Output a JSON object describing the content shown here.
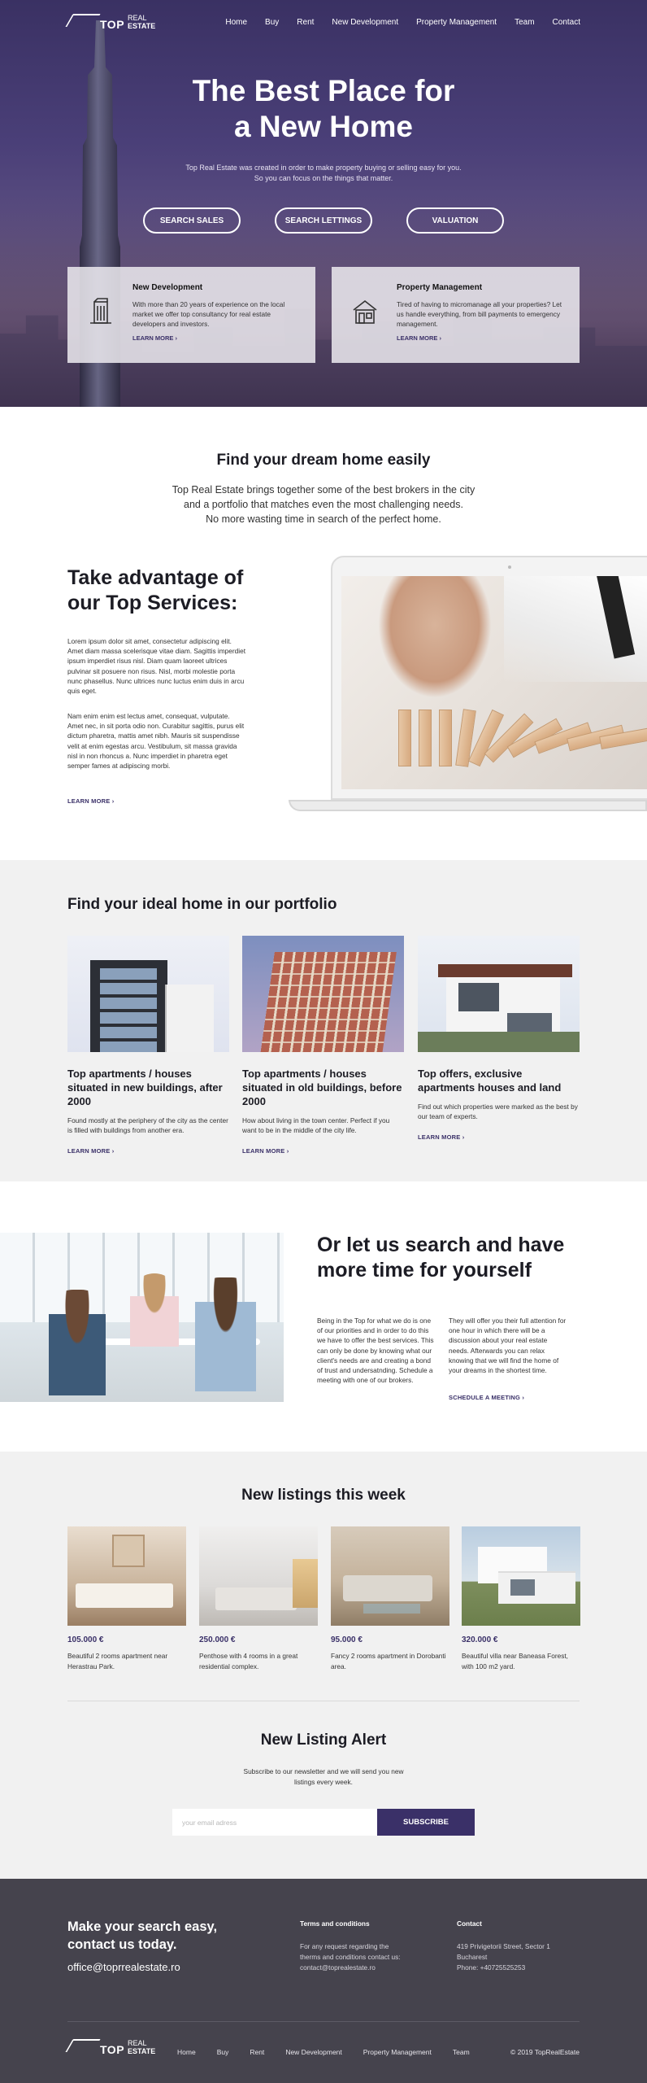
{
  "brand": {
    "logo_top": "TOP",
    "logo_real": "REAL",
    "logo_estate": "ESTATE"
  },
  "nav": [
    "Home",
    "Buy",
    "Rent",
    "New Development",
    "Property Management",
    "Team",
    "Contact"
  ],
  "hero": {
    "title_line1": "The Best Place for",
    "title_line2": "a New Home",
    "subtitle_line1": "Top Real Estate was created in order to make property buying or selling easy for you.",
    "subtitle_line2": "So you can focus on the things that matter.",
    "buttons": [
      "SEARCH SALES",
      "SEARCH LETTINGS",
      "VALUATION"
    ],
    "cards": [
      {
        "icon": "building-icon",
        "title": "New Development",
        "text": "With more than 20 years of experience on the local market we offer top consultancy for real estate developers and investors.",
        "link": "LEARN MORE"
      },
      {
        "icon": "house-icon",
        "title": "Property Management",
        "text": "Tired of having to micromanage all your properties? Let us handle everything, from bill payments to emergency management.",
        "link": "LEARN MORE"
      }
    ]
  },
  "dream": {
    "title": "Find your dream home easily",
    "line1": "Top Real Estate brings together some of the best brokers in the city",
    "line2": "and a portfolio that matches even the most challenging needs.",
    "line3": "No more wasting time in search of the perfect home."
  },
  "services": {
    "title_line1": "Take advantage of",
    "title_line2": "our Top Services:",
    "p1": "Lorem ipsum dolor sit amet, consectetur adipiscing elit. Amet diam massa scelerisque vitae diam. Sagittis imperdiet ipsum imperdiet risus nisl. Diam quam laoreet ultrices pulvinar sit posuere non risus. Nisl, morbi molestie porta nunc phasellus. Nunc ultrices nunc luctus enim duis in arcu quis eget.",
    "p2": "Nam enim enim est lectus amet, consequat, vulputate. Amet nec, in sit porta odio non. Curabitur sagittis, purus elit dictum pharetra, mattis amet nibh. Mauris sit suspendisse velit at enim egestas arcu. Vestibulum, sit massa gravida nisl in non rhoncus a. Nunc imperdiet in pharetra eget semper fames at adipiscing morbi.",
    "link": "LEARN MORE"
  },
  "portfolio": {
    "title": "Find your ideal home in our portfolio",
    "items": [
      {
        "title": "Top apartments / houses situated in new buildings, after 2000",
        "text": "Found mostly at the periphery of the city as the center is filled with buildings from another era.",
        "link": "LEARN MORE"
      },
      {
        "title": "Top apartments / houses situated in old buildings, before 2000",
        "text": "How about living in the town center. Perfect if you want to be in the middle of the city life.",
        "link": "LEARN MORE"
      },
      {
        "title": "Top offers, exclusive apartments houses and land",
        "text": "Find out which properties were marked as the best by our team of experts.",
        "link": "LEARN MORE"
      }
    ]
  },
  "search": {
    "title_line1": "Or let us search and have",
    "title_line2": "more time for yourself",
    "p1": "Being in the Top for what we do is one of our priorities and in order to do this we have to offer the best services. This can only be done by knowing what our client's needs are and creating a bond of trust and undersatnding. Schedule a meeting with one of our brokers.",
    "p2": "They will offer you their full attention for one hour in which there will be a discussion about your real estate needs. Afterwards you can relax knowing that we will find the home of your dreams in the shortest time.",
    "link": "SCHEDULE A MEETING"
  },
  "listings": {
    "title": "New listings this week",
    "items": [
      {
        "price": "105.000 €",
        "text": "Beautiful 2 rooms apartment near Herastrau Park."
      },
      {
        "price": "250.000 €",
        "text": "Penthose with 4 rooms in a great residential complex."
      },
      {
        "price": "95.000 €",
        "text": "Fancy 2 rooms apartment in Dorobanti area."
      },
      {
        "price": "320.000 €",
        "text": "Beautiful villa near Baneasa Forest, with 100 m2 yard."
      }
    ]
  },
  "alert": {
    "title": "New Listing Alert",
    "line1": "Subscribe to our newsletter and we will send you new",
    "line2": "listings every week.",
    "placeholder": "your email adress",
    "button": "SUBSCRIBE"
  },
  "footer": {
    "headline_line1": "Make your search easy,",
    "headline_line2": "contact us today.",
    "email": "office@toprrealestate.ro",
    "terms_title": "Terms and conditions",
    "terms_line1": "For any request regarding the",
    "terms_line2": "therms and conditions contact us:",
    "terms_line3": "contact@toprealestate.ro",
    "contact_title": "Contact",
    "contact_line1": "419 Privigetorii Street, Sector 1",
    "contact_line2": "Bucharest",
    "contact_line3": "Phone: +40725525253",
    "nav": [
      "Home",
      "Buy",
      "Rent",
      "New Development",
      "Property Management",
      "Team"
    ],
    "copyright": "© 2019 TopRealEstate"
  },
  "colors": {
    "accent": "#3a3068",
    "hero_top": "#3a3163",
    "footer": "#45434d",
    "section_grey": "#f1f1f1"
  }
}
